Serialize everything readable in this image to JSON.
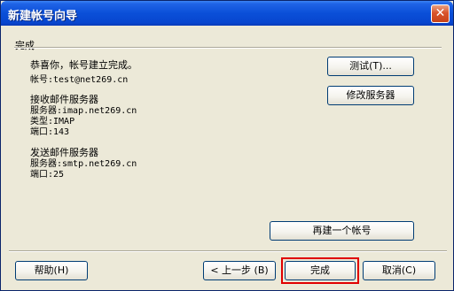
{
  "window": {
    "title": "新建帐号向导",
    "close_glyph": "✕"
  },
  "section": {
    "title": "完成"
  },
  "info": {
    "congrats": "恭喜你，帐号建立完成。",
    "account": "帐号:test@net269.cn",
    "incoming_header": "接收邮件服务器",
    "incoming_server": "服务器:imap.net269.cn",
    "incoming_type": "类型:IMAP",
    "incoming_port": "端口:143",
    "outgoing_header": "发送邮件服务器",
    "outgoing_server": "服务器:smtp.net269.cn",
    "outgoing_port": "端口:25"
  },
  "buttons": {
    "test": "测试(T)...",
    "modify_server": "修改服务器",
    "new_account": "再建一个帐号",
    "help": "帮助(H)",
    "back": "< 上一步 (B)",
    "finish": "完成",
    "cancel": "取消(C)"
  },
  "colors": {
    "title_bar": "#0a4fd8",
    "dialog_bg": "#ece9d8",
    "highlight": "#e00000"
  }
}
